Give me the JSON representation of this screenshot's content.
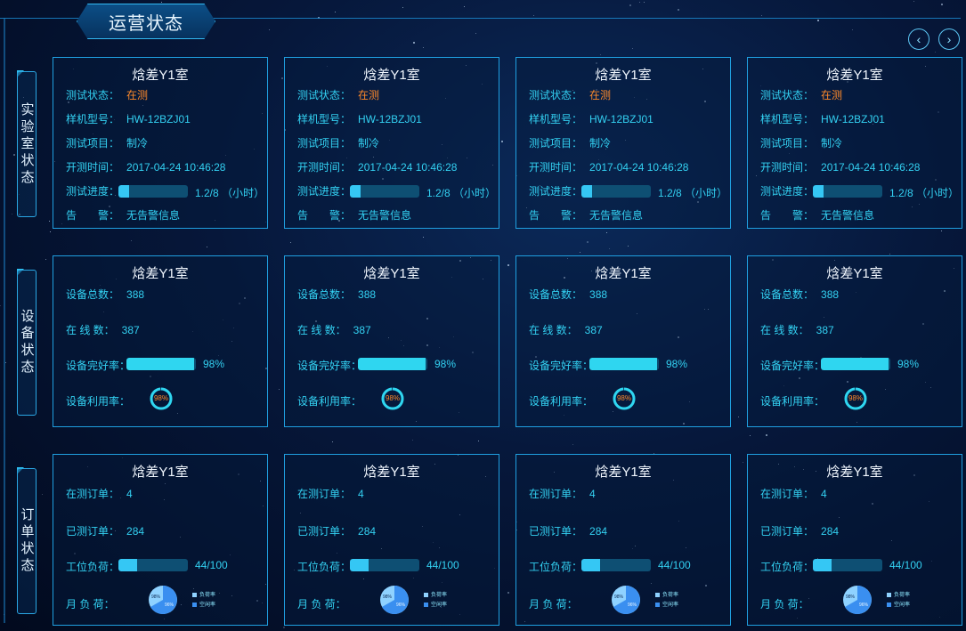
{
  "header": {
    "title": "运营状态"
  },
  "sections": {
    "lab": "实验室状态",
    "device": "设备状态",
    "order": "订单状态"
  },
  "lab_cards": [
    {
      "title": "焓差Y1室",
      "status_label": "测试状态：",
      "status": "在测",
      "model_label": "样机型号：",
      "model": "HW-12BZJ01",
      "project_label": "测试项目：",
      "project": "制冷",
      "start_label": "开测时间：",
      "start": "2017-04-24  10:46:28",
      "progress_label": "测试进度：",
      "progress_text": "1.2/8 （小时）",
      "progress_fraction": 0.15,
      "alarm_label": "告　　警：",
      "alarm": "无告警信息"
    },
    {
      "title": "焓差Y1室",
      "status_label": "测试状态：",
      "status": "在测",
      "model_label": "样机型号：",
      "model": "HW-12BZJ01",
      "project_label": "测试项目：",
      "project": "制冷",
      "start_label": "开测时间：",
      "start": "2017-04-24  10:46:28",
      "progress_label": "测试进度：",
      "progress_text": "1.2/8 （小时）",
      "progress_fraction": 0.15,
      "alarm_label": "告　　警：",
      "alarm": "无告警信息"
    },
    {
      "title": "焓差Y1室",
      "status_label": "测试状态：",
      "status": "在测",
      "model_label": "样机型号：",
      "model": "HW-12BZJ01",
      "project_label": "测试项目：",
      "project": "制冷",
      "start_label": "开测时间：",
      "start": "2017-04-24  10:46:28",
      "progress_label": "测试进度：",
      "progress_text": "1.2/8 （小时）",
      "progress_fraction": 0.15,
      "alarm_label": "告　　警：",
      "alarm": "无告警信息"
    },
    {
      "title": "焓差Y1室",
      "status_label": "测试状态：",
      "status": "在测",
      "model_label": "样机型号：",
      "model": "HW-12BZJ01",
      "project_label": "测试项目：",
      "project": "制冷",
      "start_label": "开测时间：",
      "start": "2017-04-24  10:46:28",
      "progress_label": "测试进度：",
      "progress_text": "1.2/8 （小时）",
      "progress_fraction": 0.15,
      "alarm_label": "告　　警：",
      "alarm": "无告警信息"
    }
  ],
  "device_cards": [
    {
      "title": "焓差Y1室",
      "total_label": "设备总数：",
      "total": "388",
      "online_label": "在 线 数：",
      "online": "387",
      "intact_label": "设备完好率：",
      "intact": "98%",
      "intact_fraction": 0.98,
      "util_label": "设备利用率：",
      "util": "98%",
      "util_fraction": 0.98
    },
    {
      "title": "焓差Y1室",
      "total_label": "设备总数：",
      "total": "388",
      "online_label": "在 线 数：",
      "online": "387",
      "intact_label": "设备完好率：",
      "intact": "98%",
      "intact_fraction": 0.98,
      "util_label": "设备利用率：",
      "util": "98%",
      "util_fraction": 0.98
    },
    {
      "title": "焓差Y1室",
      "total_label": "设备总数：",
      "total": "388",
      "online_label": "在 线 数：",
      "online": "387",
      "intact_label": "设备完好率：",
      "intact": "98%",
      "intact_fraction": 0.98,
      "util_label": "设备利用率：",
      "util": "98%",
      "util_fraction": 0.98
    },
    {
      "title": "焓差Y1室",
      "total_label": "设备总数：",
      "total": "388",
      "online_label": "在 线 数：",
      "online": "387",
      "intact_label": "设备完好率：",
      "intact": "98%",
      "intact_fraction": 0.98,
      "util_label": "设备利用率：",
      "util": "98%",
      "util_fraction": 0.98
    }
  ],
  "order_cards": [
    {
      "title": "焓差Y1室",
      "testing_label": "在测订单：",
      "testing": "4",
      "tested_label": "已测订单：",
      "tested": "284",
      "load_label": "工位负荷：",
      "load_text": "44/100",
      "load_fraction": 0.44,
      "month_label": "月 负 荷：",
      "pie_load": "98%",
      "pie_idle": "96%",
      "legend_load": "负荷率",
      "legend_idle": "空闲率"
    },
    {
      "title": "焓差Y1室",
      "testing_label": "在测订单：",
      "testing": "4",
      "tested_label": "已测订单：",
      "tested": "284",
      "load_label": "工位负荷：",
      "load_text": "44/100",
      "load_fraction": 0.44,
      "month_label": "月 负 荷：",
      "pie_load": "98%",
      "pie_idle": "96%",
      "legend_load": "负荷率",
      "legend_idle": "空闲率"
    },
    {
      "title": "焓差Y1室",
      "testing_label": "在测订单：",
      "testing": "4",
      "tested_label": "已测订单：",
      "tested": "284",
      "load_label": "工位负荷：",
      "load_text": "44/100",
      "load_fraction": 0.44,
      "month_label": "月 负 荷：",
      "pie_load": "98%",
      "pie_idle": "96%",
      "legend_load": "负荷率",
      "legend_idle": "空闲率"
    },
    {
      "title": "焓差Y1室",
      "testing_label": "在测订单：",
      "testing": "4",
      "tested_label": "已测订单：",
      "tested": "284",
      "load_label": "工位负荷：",
      "load_text": "44/100",
      "load_fraction": 0.44,
      "month_label": "月 负 荷：",
      "pie_load": "98%",
      "pie_idle": "96%",
      "legend_load": "负荷率",
      "legend_idle": "空闲率"
    }
  ],
  "colors": {
    "accent": "#2fd3f2",
    "warning": "#ff8a2a",
    "border": "#1f9fe0",
    "bar_track": "#0e4f73",
    "pie_primary": "#3a8ff0",
    "pie_secondary": "#8fd2ff"
  },
  "icons": {
    "prev": "chevron-left-icon",
    "next": "chevron-right-icon"
  }
}
